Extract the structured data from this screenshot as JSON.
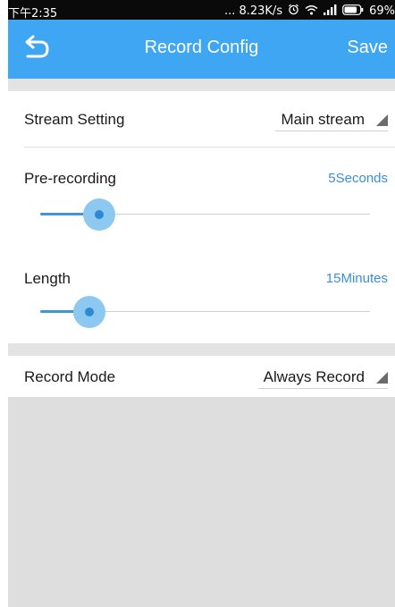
{
  "status_bar": {
    "time": "下午2:35",
    "network_speed": "... 8.23K/s",
    "battery": "69%",
    "icons": [
      "alarm-icon",
      "wifi-icon",
      "signal-icon",
      "battery-icon"
    ]
  },
  "header": {
    "title": "Record Config",
    "save_label": "Save",
    "back_icon": "back-arrow-icon"
  },
  "stream_setting": {
    "label": "Stream Setting",
    "value": "Main stream"
  },
  "pre_recording": {
    "label": "Pre-recording",
    "value": "5Seconds",
    "slider_fraction": 0.18
  },
  "length": {
    "label": "Length",
    "value": "15Minutes",
    "slider_fraction": 0.15
  },
  "record_mode": {
    "label": "Record Mode",
    "value": "Always Record"
  },
  "colors": {
    "accent": "#3ea6f2",
    "value_text": "#3a8fd8",
    "slider_fill": "#3b97da",
    "slider_halo": "#8dc8f1",
    "background": "#dedede"
  }
}
